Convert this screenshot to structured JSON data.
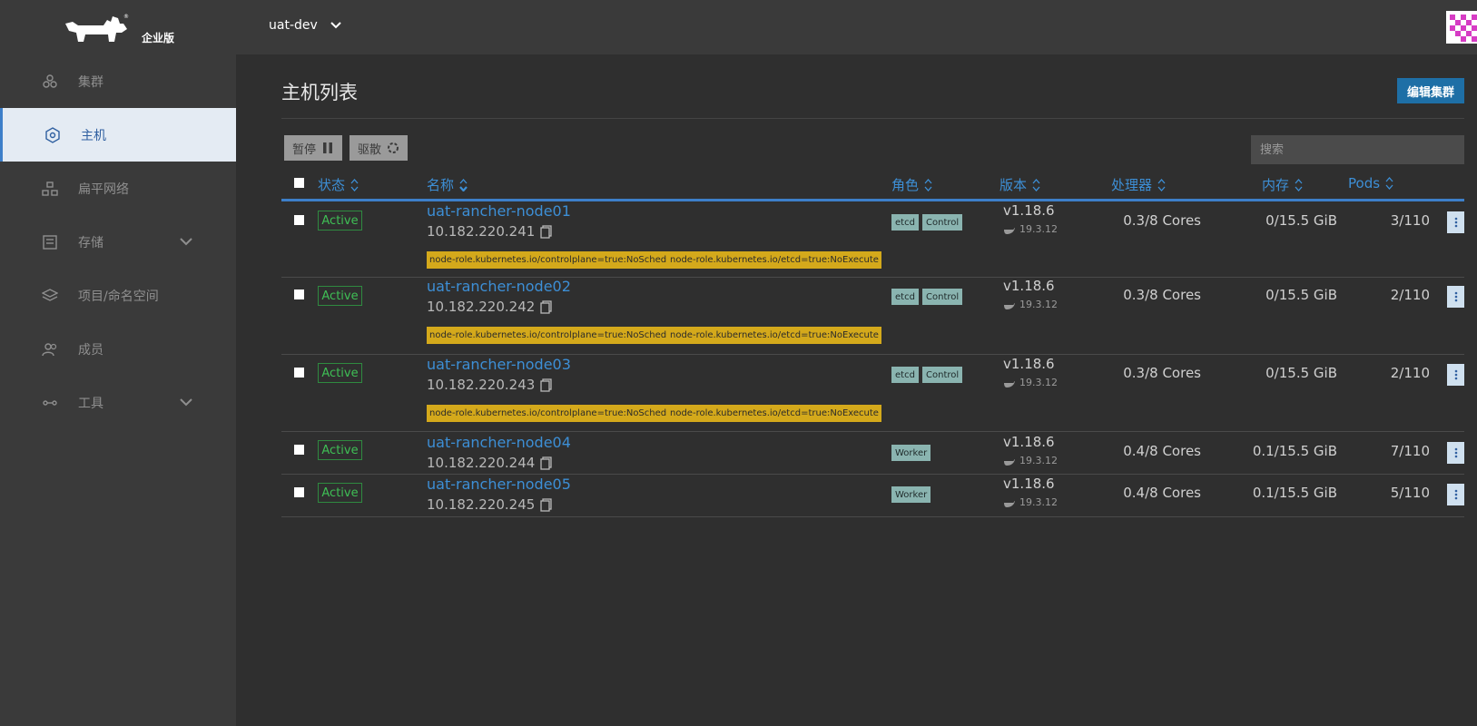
{
  "brand": {
    "edition": "企业版"
  },
  "cluster_selector": {
    "value": "uat-dev"
  },
  "sidebar": {
    "items": [
      {
        "label": "集群",
        "icon": "cluster-icon",
        "active": false,
        "expandable": false
      },
      {
        "label": "主机",
        "icon": "host-icon",
        "active": true,
        "expandable": false
      },
      {
        "label": "扁平网络",
        "icon": "network-icon",
        "active": false,
        "expandable": false
      },
      {
        "label": "存储",
        "icon": "storage-icon",
        "active": false,
        "expandable": true
      },
      {
        "label": "项目/命名空间",
        "icon": "layers-icon",
        "active": false,
        "expandable": false
      },
      {
        "label": "成员",
        "icon": "members-icon",
        "active": false,
        "expandable": false
      },
      {
        "label": "工具",
        "icon": "tools-icon",
        "active": false,
        "expandable": true
      }
    ]
  },
  "page": {
    "title": "主机列表",
    "edit_button": "编辑集群",
    "pause_button": "暂停",
    "drain_button": "驱散",
    "search_placeholder": "搜索"
  },
  "table": {
    "columns": {
      "state": "状态",
      "name": "名称",
      "roles": "角色",
      "version": "版本",
      "cpu": "处理器",
      "memory": "内存",
      "pods": "Pods"
    },
    "rows": [
      {
        "state": "Active",
        "name": "uat-rancher-node01",
        "ip": "10.182.220.241",
        "roles": [
          "etcd",
          "Control"
        ],
        "version": "v1.18.6",
        "docker": "19.3.12",
        "cpu": "0.3/8 Cores",
        "memory": "0/15.5 GiB",
        "pods": "3/110",
        "taints": [
          "node-role.kubernetes.io/controlplane=true:NoSchedule",
          "node-role.kubernetes.io/etcd=true:NoExecute"
        ]
      },
      {
        "state": "Active",
        "name": "uat-rancher-node02",
        "ip": "10.182.220.242",
        "roles": [
          "etcd",
          "Control"
        ],
        "version": "v1.18.6",
        "docker": "19.3.12",
        "cpu": "0.3/8 Cores",
        "memory": "0/15.5 GiB",
        "pods": "2/110",
        "taints": [
          "node-role.kubernetes.io/controlplane=true:NoSchedule",
          "node-role.kubernetes.io/etcd=true:NoExecute"
        ]
      },
      {
        "state": "Active",
        "name": "uat-rancher-node03",
        "ip": "10.182.220.243",
        "roles": [
          "etcd",
          "Control"
        ],
        "version": "v1.18.6",
        "docker": "19.3.12",
        "cpu": "0.3/8 Cores",
        "memory": "0/15.5 GiB",
        "pods": "2/110",
        "taints": [
          "node-role.kubernetes.io/controlplane=true:NoSchedule",
          "node-role.kubernetes.io/etcd=true:NoExecute"
        ]
      },
      {
        "state": "Active",
        "name": "uat-rancher-node04",
        "ip": "10.182.220.244",
        "roles": [
          "Worker"
        ],
        "version": "v1.18.6",
        "docker": "19.3.12",
        "cpu": "0.4/8 Cores",
        "memory": "0.1/15.5 GiB",
        "pods": "7/110",
        "taints": []
      },
      {
        "state": "Active",
        "name": "uat-rancher-node05",
        "ip": "10.182.220.245",
        "roles": [
          "Worker"
        ],
        "version": "v1.18.6",
        "docker": "19.3.12",
        "cpu": "0.4/8 Cores",
        "memory": "0.1/15.5 GiB",
        "pods": "5/110",
        "taints": []
      }
    ]
  },
  "colors": {
    "accent": "#3d8fd6",
    "active_status": "#3fbf55",
    "taint": "#d4a91b",
    "role": "#8ab4b0",
    "primary_button": "#1e6fa6"
  }
}
